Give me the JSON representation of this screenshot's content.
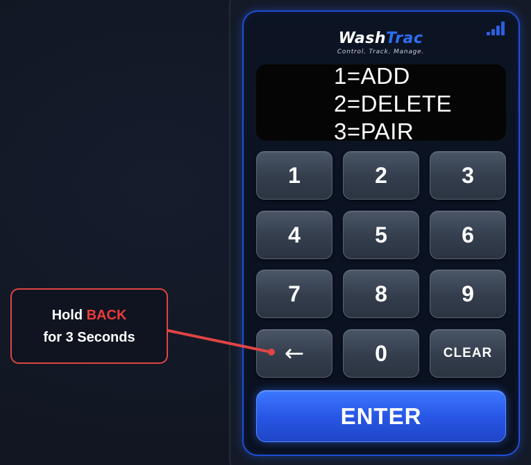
{
  "logo": {
    "wash": "Wash",
    "trac": "Trac",
    "tagline": "Control. Track. Manage."
  },
  "display": {
    "lines": [
      "1=ADD",
      "2=DELETE",
      "3=PAIR"
    ]
  },
  "keypad": {
    "k1": "1",
    "k2": "2",
    "k3": "3",
    "k4": "4",
    "k5": "5",
    "k6": "6",
    "k7": "7",
    "k8": "8",
    "k9": "9",
    "back": "←",
    "k0": "0",
    "clear": "CLEAR"
  },
  "enter_label": "ENTER",
  "callout": {
    "hold": "Hold",
    "back": "BACK",
    "line2": "for 3 Seconds"
  },
  "colors": {
    "accent_blue": "#2f6ef2",
    "highlight_red": "#ee3b3b",
    "panel_border": "#1f4fd6"
  },
  "icons": {
    "signal": "signal-strength-icon"
  }
}
